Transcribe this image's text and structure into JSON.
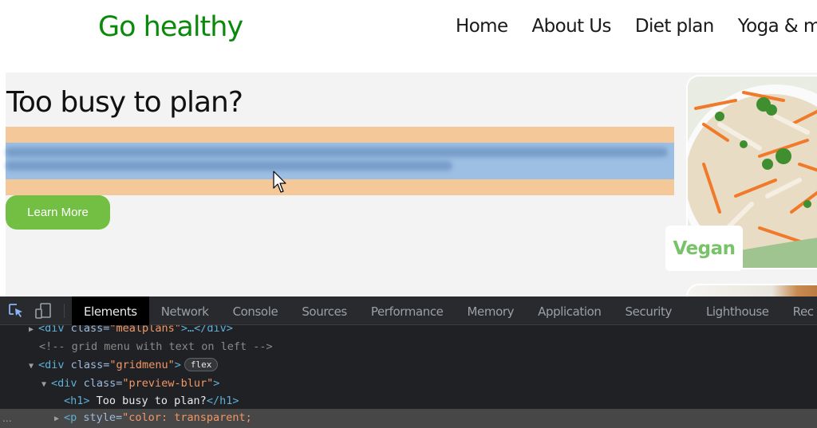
{
  "site": {
    "brand": "Go healthy",
    "nav": [
      {
        "label": "Home"
      },
      {
        "label": "About Us"
      },
      {
        "label": "Diet plan"
      },
      {
        "label": "Yoga & me"
      }
    ]
  },
  "hero": {
    "title": "Too busy to plan?",
    "paragraph_text": null,
    "paragraph_note": "Paragraph text is blurred (color: transparent) and not legible; highlighted by DevTools inspector.",
    "learn_more_label": "Learn More"
  },
  "cards": [
    {
      "label": "Vegan",
      "image": "salad-photo"
    },
    {
      "label": "",
      "image": "food-photo"
    }
  ],
  "colors": {
    "brand_green": "#0a8a0a",
    "button_green": "#72bf44",
    "card_label_green": "#78c267",
    "inspect_margin": "#f5c899",
    "inspect_content": "#9cbfe3",
    "section_bg": "#f3f3f3"
  },
  "devtools": {
    "tabs": [
      {
        "label": "Elements",
        "active": true
      },
      {
        "label": "Network"
      },
      {
        "label": "Console"
      },
      {
        "label": "Sources"
      },
      {
        "label": "Performance"
      },
      {
        "label": "Memory"
      },
      {
        "label": "Application"
      },
      {
        "label": "Security"
      },
      {
        "label": "Lighthouse"
      },
      {
        "label": "Rec"
      }
    ],
    "tree": {
      "line1": {
        "tag_open": "<div ",
        "attr": "class=",
        "val": "\"mealplans\"",
        "tail": ">…</div>"
      },
      "line2": {
        "comment": "<!-- grid menu with text on left  -->"
      },
      "line3": {
        "tag_open": "<div ",
        "attr": "class=",
        "val": "\"gridmenu\"",
        "tail": ">",
        "badge": "flex"
      },
      "line4": {
        "tag_open": "<div ",
        "attr": "class=",
        "val": "\"preview-blur\"",
        "tail": ">"
      },
      "line5": {
        "open": "<h1>",
        "text": " Too busy to plan?",
        "close": "</h1>"
      },
      "line6": {
        "tag_open": "<p ",
        "attr": "style=",
        "val": "\"color: transparent;"
      },
      "selected_dots": "..."
    }
  }
}
